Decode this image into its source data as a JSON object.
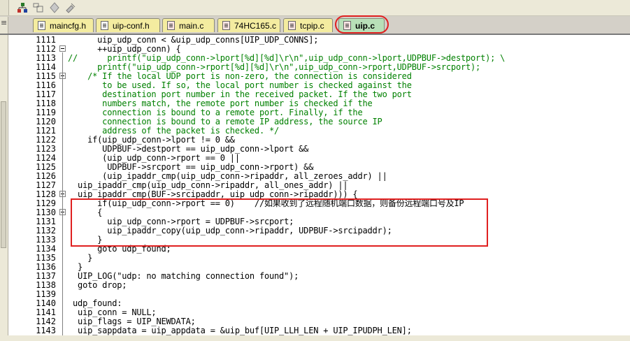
{
  "toolbar": {
    "icons": [
      "project-tree-icon",
      "window-layout-icon",
      "diamond-icon",
      "tools-icon"
    ]
  },
  "tabs": [
    {
      "label": "maincfg.h",
      "type": "h",
      "active": false
    },
    {
      "label": "uip-conf.h",
      "type": "h",
      "active": false
    },
    {
      "label": "main.c",
      "type": "c",
      "active": false
    },
    {
      "label": "74HC165.c",
      "type": "c",
      "active": false
    },
    {
      "label": "tcpip.c",
      "type": "c",
      "active": false
    },
    {
      "label": "uip.c",
      "type": "c",
      "active": true
    }
  ],
  "colors": {
    "tab_bg": "#f4eca0",
    "active_tab_bg": "#b8e0b8",
    "highlight": "#e02020",
    "comment": "#008000",
    "code": "#000000"
  },
  "editor": {
    "lines": [
      {
        "n": "1111",
        "text": "      uip_udp_conn < &uip_udp_conns[UIP_UDP_CONNS];",
        "type": "code"
      },
      {
        "n": "1112",
        "text": "      ++uip_udp_conn) {",
        "type": "code",
        "fold": true
      },
      {
        "n": "1113",
        "text": "//      printf(\"uip_udp_conn->lport[%d][%d]\\r\\n\",uip_udp_conn->lport,UDPBUF->destport); \\",
        "type": "comment"
      },
      {
        "n": "1114",
        "text": "      printf(\"uip_udp_conn->rport[%d][%d]\\r\\n\",uip_udp_conn->rport,UDPBUF->srcport);",
        "type": "comment"
      },
      {
        "n": "1115",
        "text": "    /* If the local UDP port is non-zero, the connection is considered",
        "type": "comment",
        "fold": true
      },
      {
        "n": "1116",
        "text": "       to be used. If so, the local port number is checked against the",
        "type": "comment"
      },
      {
        "n": "1117",
        "text": "       destination port number in the received packet. If the two port",
        "type": "comment"
      },
      {
        "n": "1118",
        "text": "       numbers match, the remote port number is checked if the",
        "type": "comment"
      },
      {
        "n": "1119",
        "text": "       connection is bound to a remote port. Finally, if the",
        "type": "comment"
      },
      {
        "n": "1120",
        "text": "       connection is bound to a remote IP address, the source IP",
        "type": "comment"
      },
      {
        "n": "1121",
        "text": "       address of the packet is checked. */",
        "type": "comment"
      },
      {
        "n": "1122",
        "text": "    if(uip_udp_conn->lport != 0 &&",
        "type": "code"
      },
      {
        "n": "1123",
        "text": "       UDPBUF->destport == uip_udp_conn->lport &&",
        "type": "code"
      },
      {
        "n": "1124",
        "text": "       (uip_udp_conn->rport == 0 ||",
        "type": "code"
      },
      {
        "n": "1125",
        "text": "        UDPBUF->srcport == uip_udp_conn->rport) &&",
        "type": "code"
      },
      {
        "n": "1126",
        "text": "       (uip_ipaddr_cmp(uip_udp_conn->ripaddr, all_zeroes_addr) ||",
        "type": "code"
      },
      {
        "n": "1127",
        "text": "  uip_ipaddr_cmp(uip_udp_conn->ripaddr, all_ones_addr) ||",
        "type": "code"
      },
      {
        "n": "1128",
        "text": "  uip_ipaddr_cmp(BUF->srcipaddr, uip_udp_conn->ripaddr))) {",
        "type": "code",
        "fold": true
      },
      {
        "n": "1129",
        "text": "      if(uip_udp_conn->rport == 0)    //如果收到了远程随机端口数据，则备份远程端口号及IP",
        "type": "code"
      },
      {
        "n": "1130",
        "text": "      {",
        "type": "code",
        "fold": true
      },
      {
        "n": "1131",
        "text": "        uip_udp_conn->rport = UDPBUF->srcport;",
        "type": "code"
      },
      {
        "n": "1132",
        "text": "        uip_ipaddr_copy(uip_udp_conn->ripaddr, UDPBUF->srcipaddr);",
        "type": "code"
      },
      {
        "n": "1133",
        "text": "      }",
        "type": "code"
      },
      {
        "n": "1134",
        "text": "      goto udp_found;",
        "type": "code"
      },
      {
        "n": "1135",
        "text": "    }",
        "type": "code"
      },
      {
        "n": "1136",
        "text": "  }",
        "type": "code"
      },
      {
        "n": "1137",
        "text": "  UIP_LOG(\"udp: no matching connection found\");",
        "type": "code"
      },
      {
        "n": "1138",
        "text": "  goto drop;",
        "type": "code"
      },
      {
        "n": "1139",
        "text": "",
        "type": "code"
      },
      {
        "n": "1140",
        "text": " udp_found:",
        "type": "code"
      },
      {
        "n": "1141",
        "text": "  uip_conn = NULL;",
        "type": "code"
      },
      {
        "n": "1142",
        "text": "  uip_flags = UIP_NEWDATA;",
        "type": "code"
      },
      {
        "n": "1143",
        "text": "  uip_sappdata = uip_appdata = &uip_buf[UIP_LLH_LEN + UIP_IPUDPH_LEN];",
        "type": "code"
      }
    ]
  }
}
